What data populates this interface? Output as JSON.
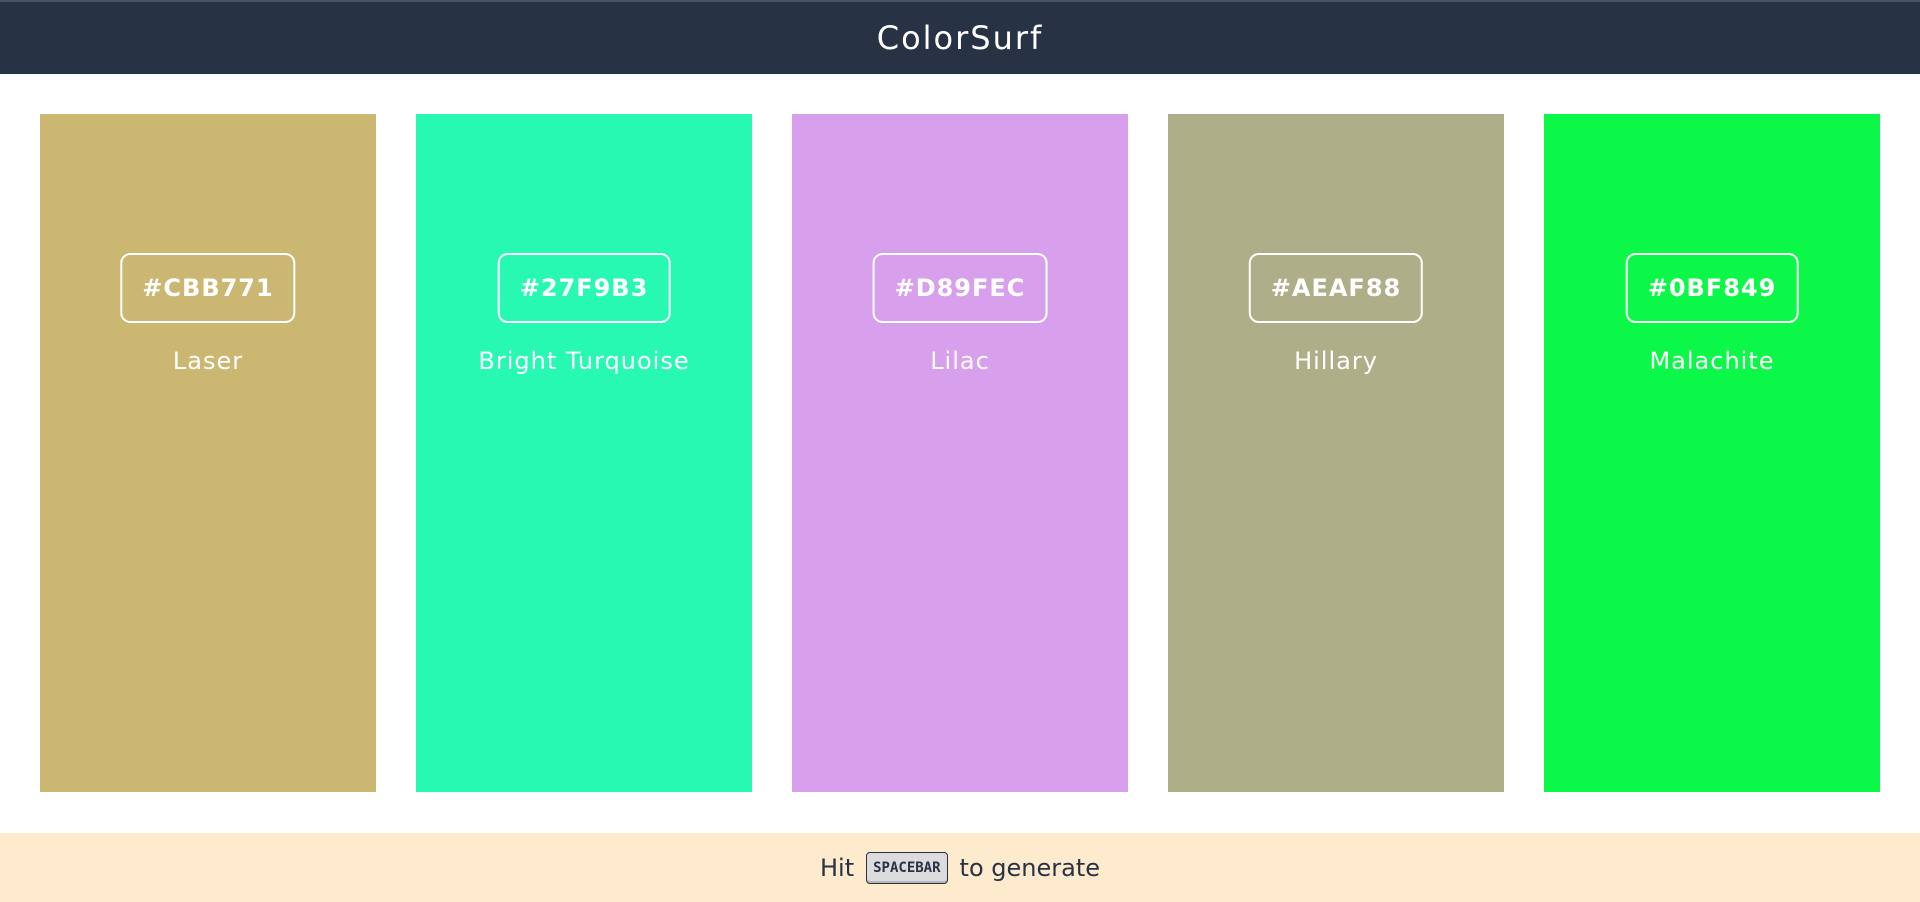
{
  "header": {
    "title": "ColorSurf",
    "background": "#283245"
  },
  "palette": [
    {
      "hex": "#CBB771",
      "name": "Laser",
      "color": "#CBB771"
    },
    {
      "hex": "#27F9B3",
      "name": "Bright Turquoise",
      "color": "#27F9B3"
    },
    {
      "hex": "#D89FEC",
      "name": "Lilac",
      "color": "#D89FEC"
    },
    {
      "hex": "#AEAF88",
      "name": "Hillary",
      "color": "#AEAF88"
    },
    {
      "hex": "#0BF849",
      "name": "Malachite",
      "color": "#0BF849"
    }
  ],
  "footer": {
    "prefix": "Hit",
    "key": "SPACEBAR",
    "suffix": "to generate",
    "background": "#FEEBCD"
  }
}
